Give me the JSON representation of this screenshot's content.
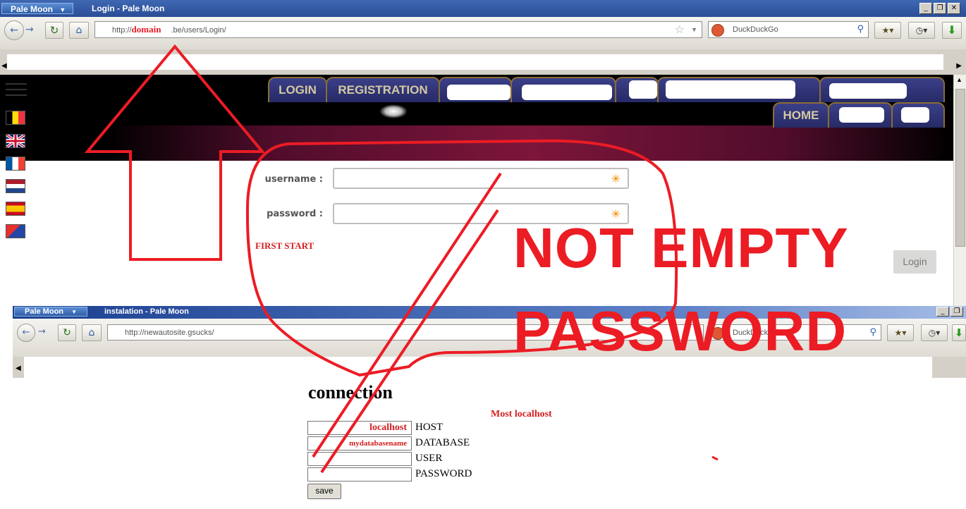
{
  "top_window": {
    "app_button": "Pale Moon",
    "title": "Login - Pale Moon",
    "controls": [
      "_",
      "❐",
      "✕"
    ],
    "url_prefix": "http://",
    "url_highlight": "domain",
    "url_suffix": ".be/users/Login/",
    "search_placeholder": "DuckDuckGo"
  },
  "site": {
    "nav_row1": [
      "LOGIN",
      "REGISTRATION"
    ],
    "nav_row2": [
      "HOME"
    ],
    "flags": [
      "belgium-flag-icon",
      "uk-flag-icon",
      "france-flag-icon",
      "netherlands-flag-icon",
      "spain-flag-icon",
      "catalonia-flag-icon"
    ]
  },
  "login_form": {
    "username_label": "username :",
    "password_label": "password :",
    "required_mark": "✳",
    "first_start": "FIRST START",
    "login_button": "Login"
  },
  "annotation": {
    "line1": "NOT EMPTY",
    "line2": "PASSWORD",
    "color": "#ec1c24"
  },
  "bottom_window": {
    "app_button": "Pale Moon",
    "title": "instalation - Pale Moon",
    "url": "http://newautosite.gsucks/",
    "search_placeholder": "DuckDuckGo"
  },
  "install_form": {
    "title": "connection",
    "note": "Most localhost",
    "rows": [
      {
        "value": "localhost",
        "label": "HOST"
      },
      {
        "value": "mydatabasename",
        "label": "DATABASE"
      },
      {
        "value": "",
        "label": "USER"
      },
      {
        "value": "",
        "label": "PASSWORD"
      }
    ],
    "save_button": "save"
  }
}
